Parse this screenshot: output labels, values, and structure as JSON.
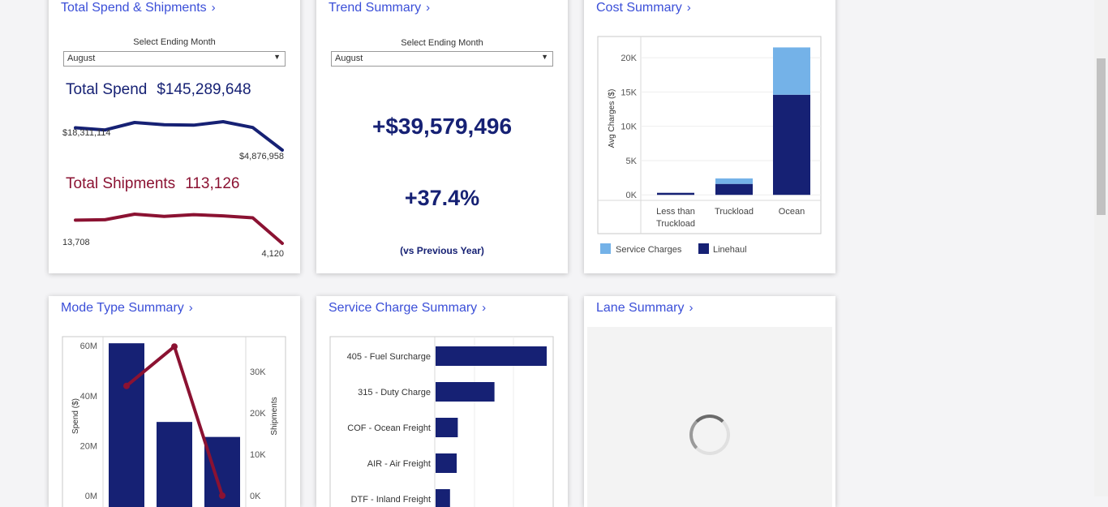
{
  "colors": {
    "navy": "#162174",
    "crimson": "#8b1232",
    "light_blue": "#74b2e8",
    "link": "#3b4fd8"
  },
  "total_spend": {
    "title": "Total Spend & Shipments",
    "select_label": "Select Ending Month",
    "select_value": "August",
    "spend_label": "Total Spend",
    "spend_value": "$145,289,648",
    "spend_start_label": "$18,311,114",
    "spend_end_label": "$4,876,958",
    "shipments_label": "Total Shipments",
    "shipments_value": "113,126",
    "shipments_start_label": "13,708",
    "shipments_end_label": "4,120"
  },
  "trend": {
    "title": "Trend Summary",
    "select_label": "Select Ending Month",
    "select_value": "August",
    "change_amount": "+$39,579,496",
    "change_percent": "+37.4%",
    "note": "(vs Previous Year)"
  },
  "cost": {
    "title": "Cost Summary",
    "ylabel": "Avg Charges ($)",
    "legend": [
      "Service Charges",
      "Linehaul"
    ]
  },
  "mode": {
    "title": "Mode Type Summary",
    "ylabel_left": "Spend ($)",
    "ylabel_right": "Shipments"
  },
  "service": {
    "title": "Service Charge Summary"
  },
  "lane": {
    "title": "Lane Summary"
  },
  "chart_data": [
    {
      "type": "line",
      "title": "Total Spend",
      "series": [
        {
          "name": "Total Spend",
          "values": [
            18311114,
            17000000,
            21500000,
            20200000,
            19900000,
            22000000,
            18500000,
            4876958
          ]
        }
      ]
    },
    {
      "type": "line",
      "title": "Total Shipments",
      "series": [
        {
          "name": "Total Shipments",
          "values": [
            13708,
            13900,
            16200,
            15300,
            16000,
            15500,
            14700,
            4120
          ]
        }
      ]
    },
    {
      "type": "bar",
      "stacked": true,
      "categories": [
        "Less than Truckload",
        "Truckload",
        "Ocean"
      ],
      "series": [
        {
          "name": "Linehaul",
          "values": [
            300,
            1600,
            14600
          ]
        },
        {
          "name": "Service Charges",
          "values": [
            0,
            800,
            6900
          ]
        }
      ],
      "ylabel": "Avg Charges ($)",
      "yticks": [
        "0K",
        "5K",
        "10K",
        "15K",
        "20K"
      ],
      "ylim": [
        -800,
        22500
      ]
    },
    {
      "type": "bar",
      "combo_line": true,
      "categories": [
        "",
        "",
        ""
      ],
      "series": [
        {
          "name": "Spend ($)",
          "values": [
            61000000,
            29500000,
            23500000
          ]
        },
        {
          "name": "Shipments",
          "values": [
            26500,
            36000,
            0
          ]
        }
      ],
      "yticks_left": [
        "0M",
        "20M",
        "40M",
        "60M"
      ],
      "yticks_right": [
        "0K",
        "10K",
        "20K",
        "30K"
      ],
      "ylim_left": [
        0,
        63000000
      ],
      "ylim_right": [
        0,
        38000
      ]
    },
    {
      "type": "bar",
      "orientation": "horizontal",
      "categories": [
        "405 - Fuel Surcharge",
        "315 - Duty Charge",
        "COF - Ocean Freight",
        "AIR - Air Freight",
        "DTF - Inland Freight"
      ],
      "values": [
        100,
        53,
        20,
        19,
        13
      ]
    }
  ]
}
